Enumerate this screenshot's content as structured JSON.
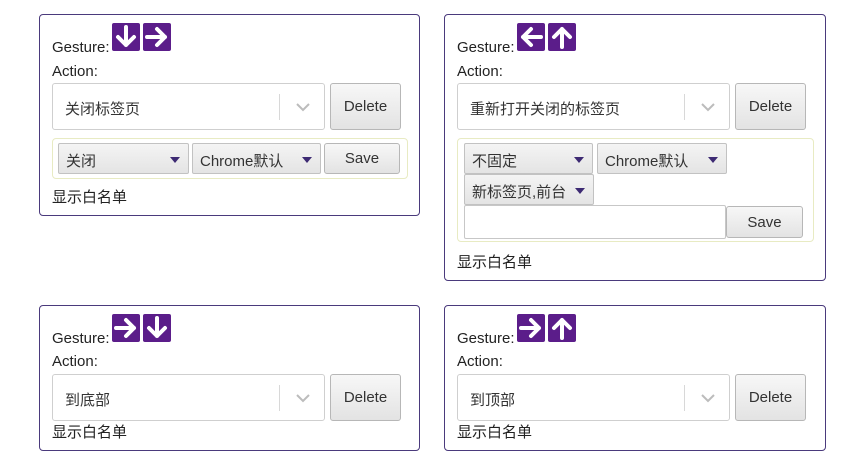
{
  "gesture_label": "Gesture:",
  "action_label": "Action:",
  "delete_label": "Delete",
  "save_label": "Save",
  "whitelist_label": "显示白名单",
  "colors": {
    "arrow_bg": "#5b1d8a",
    "card_border": "#4a3a7c",
    "options_border": "#e8ebc3"
  },
  "cards": [
    {
      "gesture": [
        "arrow-down",
        "arrow-right"
      ],
      "action": "关闭标签页",
      "options": {
        "select1": "关闭",
        "select2": "Chrome默认"
      }
    },
    {
      "gesture": [
        "arrow-left",
        "arrow-up"
      ],
      "action": "重新打开关闭的标签页",
      "options": {
        "select1": "不固定",
        "select2": "Chrome默认",
        "select3": "新标签页,前台",
        "text_value": ""
      }
    },
    {
      "gesture": [
        "arrow-right",
        "arrow-down"
      ],
      "action": "到底部"
    },
    {
      "gesture": [
        "arrow-right",
        "arrow-up"
      ],
      "action": "到顶部"
    }
  ]
}
